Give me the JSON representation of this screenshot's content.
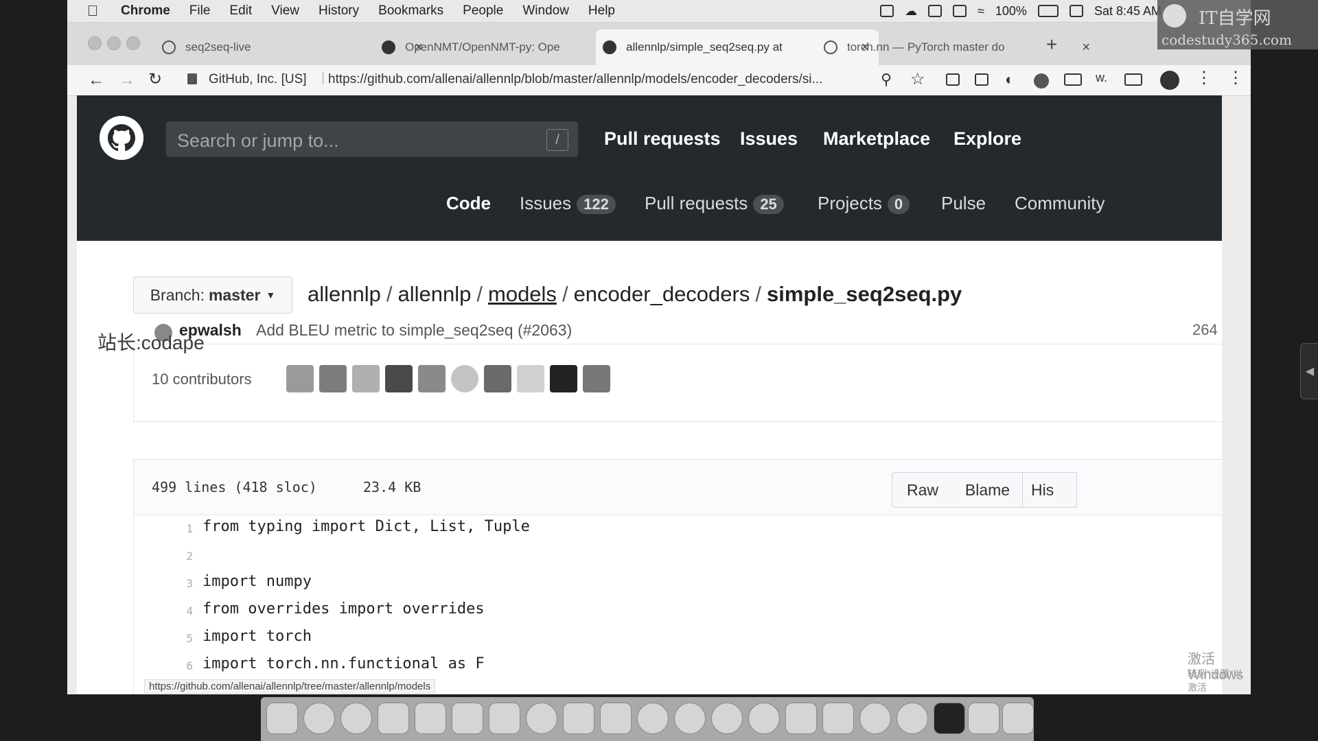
{
  "menubar": {
    "app": "Chrome",
    "items": [
      "File",
      "Edit",
      "View",
      "History",
      "Bookmarks",
      "People",
      "Window",
      "Help"
    ],
    "battery": "100%",
    "clock": "Sat 8:45 AM"
  },
  "tabs": [
    {
      "title": "seq2seq-live"
    },
    {
      "title": "OpenNMT/OpenNMT-py: Ope"
    },
    {
      "title": "allennlp/simple_seq2seq.py at"
    },
    {
      "title": "torch.nn — PyTorch master do"
    }
  ],
  "addressbar": {
    "site_identity": "GitHub, Inc. [US]",
    "url": "https://github.com/allenai/allennlp/blob/master/allennlp/models/encoder_decoders/si..."
  },
  "github": {
    "search_placeholder": "Search or jump to...",
    "search_shortcut": "/",
    "topnav": [
      "Pull requests",
      "Issues",
      "Marketplace",
      "Explore"
    ],
    "reponav": {
      "code": "Code",
      "issues": "Issues",
      "issues_count": "122",
      "pulls": "Pull requests",
      "pulls_count": "25",
      "projects": "Projects",
      "projects_count": "0",
      "pulse": "Pulse",
      "community": "Community"
    }
  },
  "file": {
    "branch_label": "Branch:",
    "branch": "master",
    "breadcrumb": [
      "allennlp",
      "allennlp",
      "models",
      "encoder_decoders"
    ],
    "filename": "simple_seq2seq.py",
    "commit_author": "epwalsh",
    "commit_message": "Add BLEU metric to simple_seq2seq (#2063)",
    "commit_hash_partial": "264",
    "contributors": "10 contributors",
    "stats_lines": "499 lines (418 sloc)",
    "stats_size": "23.4 KB",
    "buttons": [
      "Raw",
      "Blame",
      "His"
    ]
  },
  "code": [
    {
      "n": "1",
      "text": "from typing import Dict, List, Tuple"
    },
    {
      "n": "2",
      "text": ""
    },
    {
      "n": "3",
      "text": "import numpy"
    },
    {
      "n": "4",
      "text": "from overrides import overrides"
    },
    {
      "n": "5",
      "text": "import torch"
    },
    {
      "n": "6",
      "text": "import torch.nn.functional as F"
    }
  ],
  "statusbar_url": "https://github.com/allenai/allennlp/tree/master/allennlp/models",
  "watermark": {
    "site": "IT自学网",
    "domain": "codestudy365.com",
    "side_text": "站长:codape"
  },
  "activation": {
    "title": "激活 Windows",
    "subtitle": "转到\"设置\"以激活 Windows。"
  }
}
